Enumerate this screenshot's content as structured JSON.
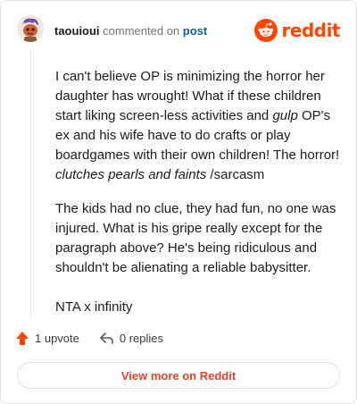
{
  "header": {
    "username": "taouioui",
    "action_text": "commented on",
    "target_link": "post",
    "avatar_icon": "snoo-avatar-icon",
    "brand": "reddit",
    "brand_color": "#ff4500"
  },
  "comment": {
    "paragraphs": [
      {
        "segments": [
          {
            "text": "I can't believe OP is minimizing the horror her daughter has wrought! What if these children start liking screen-less activities and ",
            "italic": false
          },
          {
            "text": "gulp",
            "italic": true
          },
          {
            "text": " OP's ex and his wife have to do crafts or play boardgames with their own children! The horror! ",
            "italic": false
          },
          {
            "text": "clutches pearls and faints",
            "italic": true
          },
          {
            "text": " /sarcasm",
            "italic": false
          }
        ]
      },
      {
        "segments": [
          {
            "text": "The kids had no clue, they had fun, no one was injured. What is his gripe really except for the paragraph above? He's being ridiculous and shouldn't be alienating a reliable babysitter.",
            "italic": false
          }
        ]
      },
      {
        "segments": [
          {
            "text": "NTA x infinity",
            "italic": false
          }
        ]
      }
    ]
  },
  "actions": {
    "upvote_label": "1 upvote",
    "upvote_icon": "upvote-arrow-icon",
    "upvote_color": "#ff4500",
    "replies_label": "0 replies",
    "replies_icon": "reply-arrow-icon"
  },
  "cta": {
    "label": "View more on Reddit",
    "color": "#e0452b"
  }
}
